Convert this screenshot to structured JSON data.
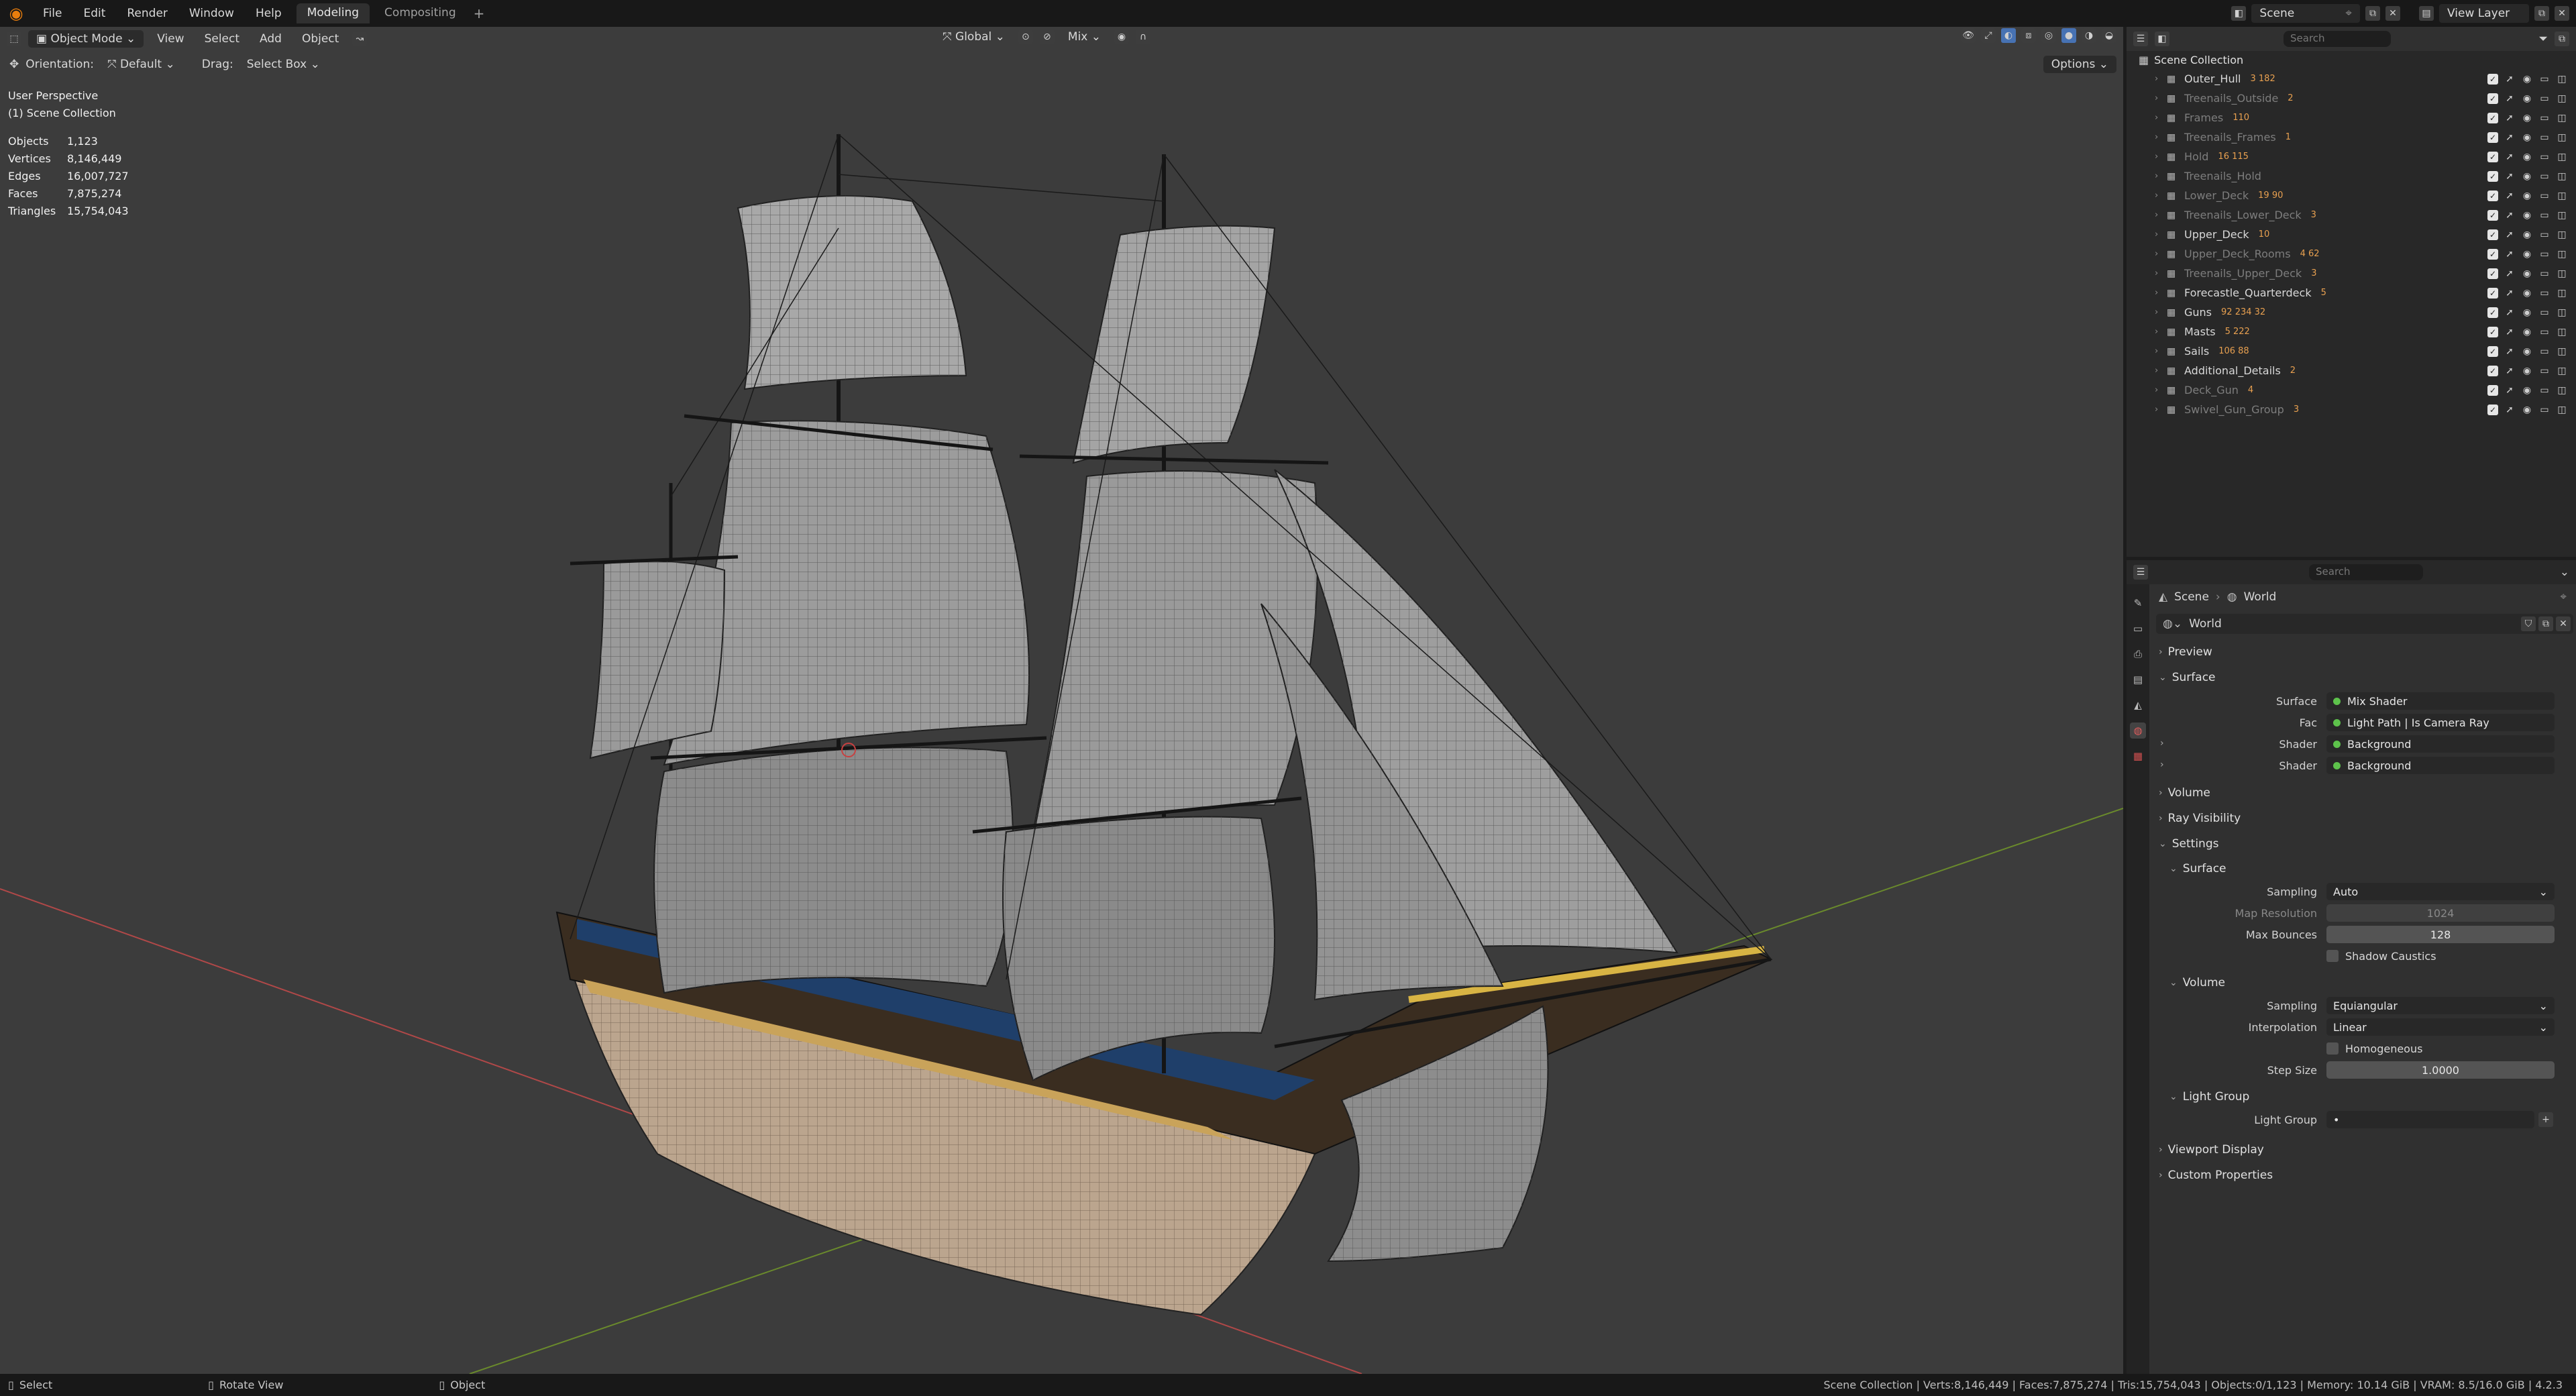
{
  "topbar": {
    "menus": [
      "File",
      "Edit",
      "Render",
      "Window",
      "Help"
    ],
    "workspaces": [
      "Modeling",
      "Compositing"
    ],
    "scene": "Scene",
    "view_layer": "View Layer"
  },
  "viewport": {
    "mode": "Object Mode",
    "menus": [
      "View",
      "Select",
      "Add",
      "Object"
    ],
    "transform": "Global",
    "snap": "Mix",
    "orientation_label": "Orientation:",
    "orientation": "Default",
    "drag_label": "Drag:",
    "drag": "Select Box",
    "options": "Options",
    "perspective": "User Perspective",
    "collection": "(1) Scene Collection",
    "stats": [
      {
        "label": "Objects",
        "value": "1,123"
      },
      {
        "label": "Vertices",
        "value": "8,146,449"
      },
      {
        "label": "Edges",
        "value": "16,007,727"
      },
      {
        "label": "Faces",
        "value": "7,875,274"
      },
      {
        "label": "Triangles",
        "value": "15,754,043"
      }
    ]
  },
  "outliner": {
    "search_placeholder": "Search",
    "root": "Scene Collection",
    "items": [
      {
        "name": "Outer_Hull",
        "count": "3 182",
        "dim": false
      },
      {
        "name": "Treenails_Outside",
        "count": "2",
        "dim": true
      },
      {
        "name": "Frames",
        "count": "110",
        "dim": true
      },
      {
        "name": "Treenails_Frames",
        "count": "1",
        "dim": true
      },
      {
        "name": "Hold",
        "count": "16 115",
        "dim": true
      },
      {
        "name": "Treenails_Hold",
        "count": "",
        "dim": true
      },
      {
        "name": "Lower_Deck",
        "count": "19 90",
        "dim": true
      },
      {
        "name": "Treenails_Lower_Deck",
        "count": "3",
        "dim": true
      },
      {
        "name": "Upper_Deck",
        "count": "10",
        "dim": false
      },
      {
        "name": "Upper_Deck_Rooms",
        "count": "4 62",
        "dim": true
      },
      {
        "name": "Treenails_Upper_Deck",
        "count": "3",
        "dim": true
      },
      {
        "name": "Forecastle_Quarterdeck",
        "count": "5",
        "dim": false
      },
      {
        "name": "Guns",
        "count": "92 234 32",
        "dim": false
      },
      {
        "name": "Masts",
        "count": "5 222",
        "dim": false
      },
      {
        "name": "Sails",
        "count": "106 88",
        "dim": false
      },
      {
        "name": "Additional_Details",
        "count": "2",
        "dim": false
      },
      {
        "name": "Deck_Gun",
        "count": "4",
        "dim": true
      },
      {
        "name": "Swivel_Gun_Group",
        "count": "3",
        "dim": true
      }
    ]
  },
  "properties": {
    "search_placeholder": "Search",
    "breadcrumb": [
      "Scene",
      "World"
    ],
    "world_name": "World",
    "sections": {
      "preview": "Preview",
      "surface": "Surface",
      "volume": "Volume",
      "ray_visibility": "Ray Visibility",
      "settings": "Settings",
      "settings_surface": "Surface",
      "settings_volume": "Volume",
      "light_group": "Light Group",
      "viewport_display": "Viewport Display",
      "custom_properties": "Custom Properties"
    },
    "surface_rows": [
      {
        "label": "Surface",
        "value": "Mix Shader"
      },
      {
        "label": "Fac",
        "value": "Light Path | Is Camera Ray"
      },
      {
        "label": "Shader",
        "value": "Background"
      },
      {
        "label": "Shader",
        "value": "Background"
      }
    ],
    "settings_surface_rows": {
      "sampling_label": "Sampling",
      "sampling": "Auto",
      "map_res_label": "Map Resolution",
      "map_res": "1024",
      "max_bounces_label": "Max Bounces",
      "max_bounces": "128",
      "shadow_caustics": "Shadow Caustics"
    },
    "settings_volume_rows": {
      "sampling_label": "Sampling",
      "sampling": "Equiangular",
      "interp_label": "Interpolation",
      "interp": "Linear",
      "homogeneous": "Homogeneous",
      "step_label": "Step Size",
      "step": "1.0000"
    },
    "light_group_label": "Light Group"
  },
  "statusbar": {
    "select": "Select",
    "rotate": "Rotate View",
    "object": "Object",
    "stats": "Scene Collection | Verts:8,146,449 | Faces:7,875,274 | Tris:15,754,043 | Objects:0/1,123 | Memory: 10.14 GiB | VRAM: 8.5/16.0 GiB | 4.2.3"
  },
  "colors": {
    "accent_orange": "#e87d0d",
    "node_green": "#5dc24b",
    "axis_x": "#b04848",
    "axis_y": "#6a8a2c"
  }
}
